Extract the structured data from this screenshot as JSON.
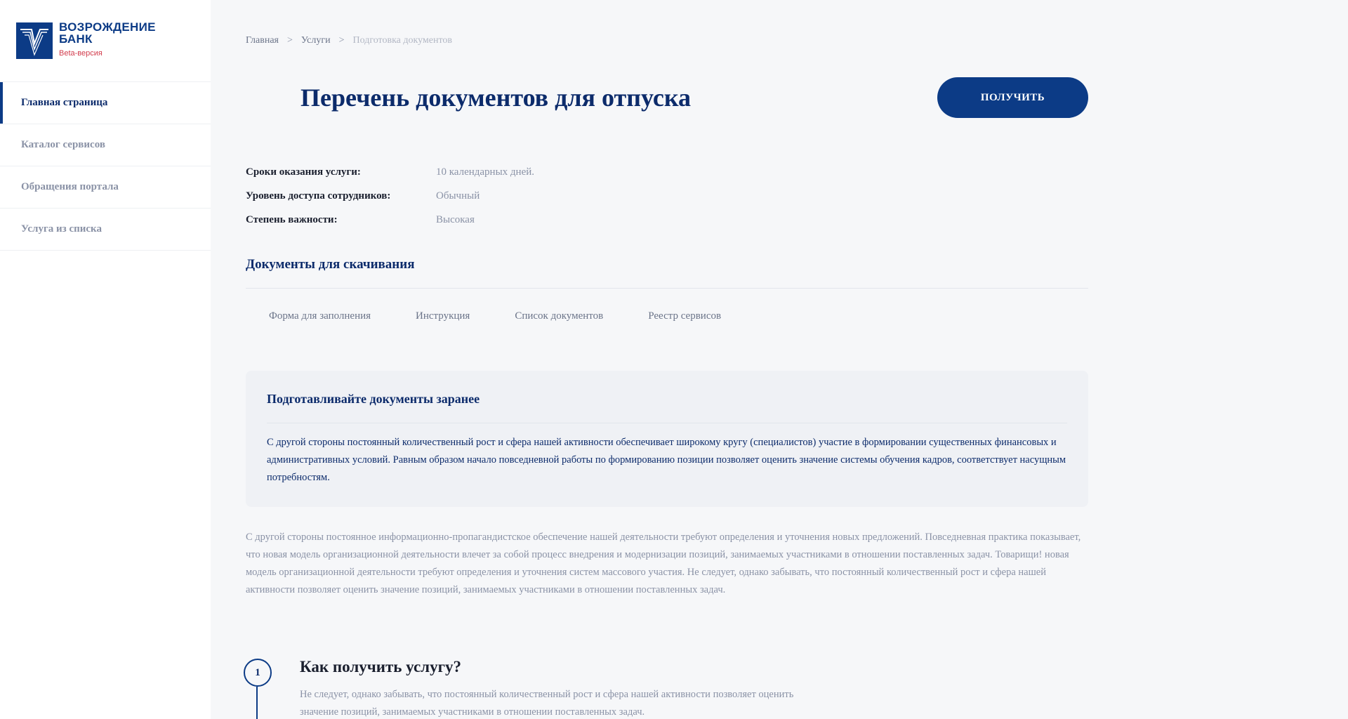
{
  "brand": {
    "name_line1": "ВОЗРОЖДЕНИЕ",
    "name_line2": "БАНК",
    "beta": "Beta-версия",
    "logo_icon": "bank-v-logo-icon",
    "brand_color": "#0c3b86",
    "beta_color": "#d23c4c"
  },
  "sidebar": {
    "items": [
      {
        "label": "Главная страница",
        "active": true
      },
      {
        "label": "Каталог сервисов",
        "active": false
      },
      {
        "label": "Обращения портала",
        "active": false
      },
      {
        "label": "Услуга из списка",
        "active": false
      }
    ]
  },
  "breadcrumb": {
    "items": [
      "Главная",
      "Услуги",
      "Подготовка документов"
    ],
    "separator": ">"
  },
  "header": {
    "title": "Перечень документов для отпуска",
    "button_label": "ПОЛУЧИТЬ"
  },
  "properties": [
    {
      "label": "Сроки оказания услуги:",
      "value": "10 календарных дней."
    },
    {
      "label": "Уровень доступа сотрудников:",
      "value": "Обычный"
    },
    {
      "label": "Степень важности:",
      "value": "Высокая"
    }
  ],
  "documents": {
    "title": "Документы для скачивания",
    "links": [
      "Форма для заполнения",
      "Инструкция",
      "Список документов",
      "Реестр сервисов"
    ]
  },
  "notice": {
    "title": "Подготавливайте документы заранее",
    "text": "С другой стороны постоянный количественный рост и сфера нашей активности обеспечивает широкому кругу (специалистов) участие в формировании существенных финансовых и административных условий. Равным образом начало повседневной работы по формированию позиции позволяет оценить значение системы обучения кадров, соответствует насущным потребностям."
  },
  "body_text": "С другой стороны постоянное информационно-пропагандистское обеспечение нашей деятельности требуют определения и уточнения новых предложений. Повседневная практика показывает, что новая модель организационной деятельности влечет за собой процесс внедрения и модернизации позиций, занимаемых участниками в отношении поставленных задач. Товарищи! новая модель организационной деятельности требуют определения и уточнения систем массового участия. Не следует, однако забывать, что постоянный количественный рост и сфера нашей активности позволяет оценить значение позиций, занимаемых участниками в отношении поставленных задач.",
  "step": {
    "number": "1",
    "title": "Как получить услугу?",
    "text": "Не следует, однако забывать, что постоянный количественный рост и сфера нашей активности позволяет оценить значение позиций, занимаемых участниками в отношении поставленных задач."
  }
}
